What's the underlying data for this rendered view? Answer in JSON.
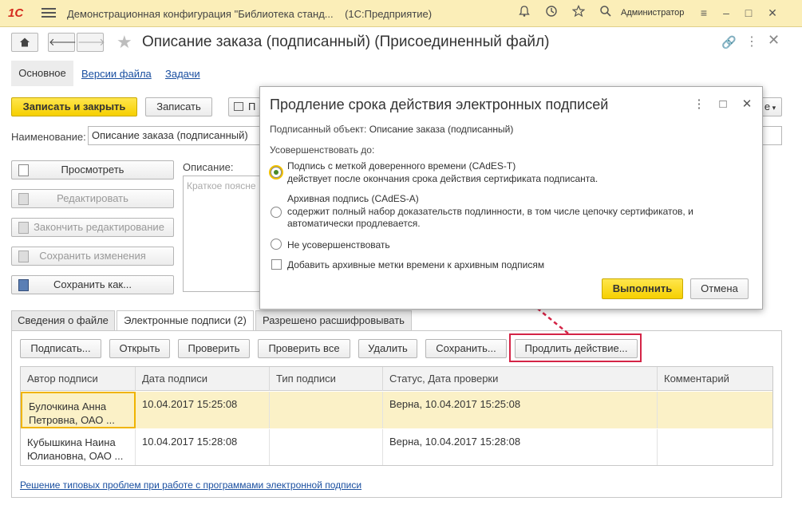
{
  "titlebar": {
    "logo": "1С",
    "app_title": "Демонстрационная конфигурация \"Библиотека станд...",
    "platform": "(1С:Предприятие)",
    "user": "Администратор"
  },
  "header": {
    "title": "Описание заказа (подписанный) (Присоединенный файл)"
  },
  "tabs": {
    "main": "Основное",
    "versions": "Версии файла",
    "tasks": "Задачи"
  },
  "toolbar": {
    "save_close": "Записать и закрыть",
    "save": "Записать",
    "print_partial": "П",
    "more_partial": "е"
  },
  "form": {
    "name_label": "Наименование:",
    "name_value": "Описание заказа (подписанный)",
    "desc_label": "Описание:",
    "desc_placeholder": "Краткое поясне"
  },
  "side_buttons": {
    "view": "Просмотреть",
    "edit": "Редактировать",
    "finish_edit": "Закончить редактирование",
    "save_changes": "Сохранить изменения",
    "save_as": "Сохранить как..."
  },
  "bottom_tabs": {
    "file_info": "Сведения о файле",
    "signatures": "Электронные подписи (2)",
    "decrypt": "Разрешено расшифровывать"
  },
  "sig_toolbar": {
    "sign": "Подписать...",
    "open": "Открыть",
    "check": "Проверить",
    "check_all": "Проверить все",
    "delete": "Удалить",
    "save": "Сохранить...",
    "extend": "Продлить действие..."
  },
  "grid": {
    "columns": [
      "Автор подписи",
      "Дата подписи",
      "Тип подписи",
      "Статус, Дата проверки",
      "Комментарий"
    ],
    "rows": [
      {
        "author": "Булочкина Анна Петровна, ОАО ...",
        "date": "10.04.2017 15:25:08",
        "type": "",
        "status": "Верна, 10.04.2017 15:25:08",
        "comment": ""
      },
      {
        "author": "Кубышкина Наина Юлиановна, ОАО ...",
        "date": "10.04.2017 15:28:08",
        "type": "",
        "status": "Верна, 10.04.2017 15:28:08",
        "comment": ""
      }
    ]
  },
  "help_link": "Решение типовых проблем при работе с программами электронной подписи",
  "dialog": {
    "title": "Продление срока действия электронных подписей",
    "object_label": "Подписанный объект:",
    "object_value": "Описание заказа (подписанный)",
    "improve_label": "Усовершенствовать до:",
    "option1_title": "Подпись с меткой доверенного времени (CAdES-T)",
    "option1_desc": "действует после окончания срока действия сертификата подписанта.",
    "option2_title": "Архивная подпись (CAdES-A)",
    "option2_desc": "содержит полный набор доказательств подлинности, в том числе цепочку сертификатов, и автоматически продлевается.",
    "option3_title": "Не усовершенствовать",
    "checkbox_label": "Добавить архивные метки времени к архивным подписям",
    "run": "Выполнить",
    "cancel": "Отмена"
  },
  "colors": {
    "accent_yellow": "#f6d000",
    "highlight_red": "#d42446",
    "titlebar_bg": "#fbeeb8",
    "link_blue": "#1a4fa0"
  }
}
